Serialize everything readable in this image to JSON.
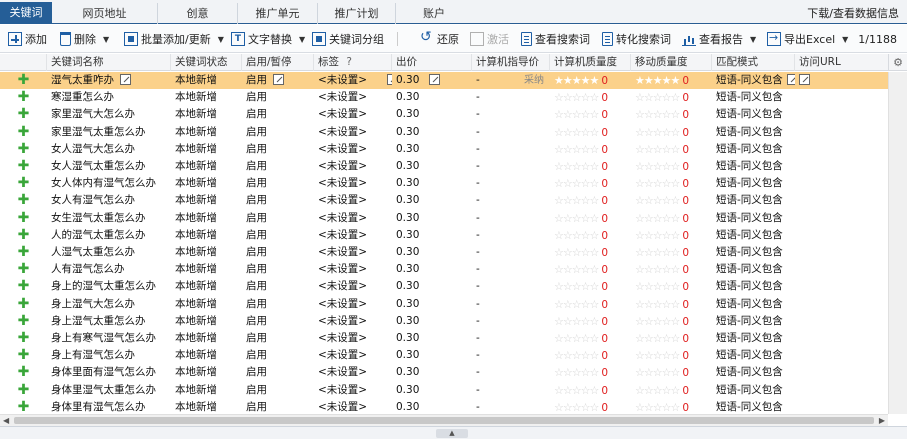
{
  "tabs": [
    {
      "label": "关键词",
      "active": true
    },
    {
      "label": "网页地址"
    },
    {
      "label": "创意"
    },
    {
      "label": "推广单元"
    },
    {
      "label": "推广计划"
    },
    {
      "label": "账户"
    }
  ],
  "tab_right": "下载/查看数据信息",
  "toolbar": {
    "add": "添加",
    "delete": "删除",
    "batch": "批量添加/更新",
    "text_replace": "文字替换",
    "group": "关键词分组",
    "restore": "还原",
    "activate": "激活",
    "search_terms": "查看搜索词",
    "convert_terms": "转化搜索词",
    "report": "查看报告",
    "export": "导出Excel",
    "pager": "1/1188"
  },
  "columns": [
    "关键词名称",
    "关键词状态",
    "启用/暂停",
    "标签",
    "出价",
    "计算机指导价",
    "计算机质量度",
    "移动质量度",
    "匹配模式",
    "访问URL"
  ],
  "tag_help": "?",
  "caina": "采纳",
  "stars": "☆☆☆☆☆",
  "stars_filled": "★★★★★",
  "quality_value": "0",
  "add_icon": "✚",
  "gear_icon": "⚙",
  "rows": [
    {
      "keyword": "湿气太重咋办",
      "status": "本地新增",
      "enabled": "启用",
      "tag": "<未设置>",
      "bid": "0.30",
      "guide": "-",
      "match": "短语-同义包含",
      "selected": true
    },
    {
      "keyword": "寒湿重怎么办",
      "status": "本地新增",
      "enabled": "启用",
      "tag": "<未设置>",
      "bid": "0.30",
      "guide": "-",
      "match": "短语-同义包含"
    },
    {
      "keyword": "家里湿气大怎么办",
      "status": "本地新增",
      "enabled": "启用",
      "tag": "<未设置>",
      "bid": "0.30",
      "guide": "-",
      "match": "短语-同义包含"
    },
    {
      "keyword": "家里湿气太重怎么办",
      "status": "本地新增",
      "enabled": "启用",
      "tag": "<未设置>",
      "bid": "0.30",
      "guide": "-",
      "match": "短语-同义包含"
    },
    {
      "keyword": "女人湿气大怎么办",
      "status": "本地新增",
      "enabled": "启用",
      "tag": "<未设置>",
      "bid": "0.30",
      "guide": "-",
      "match": "短语-同义包含"
    },
    {
      "keyword": "女人湿气太重怎么办",
      "status": "本地新增",
      "enabled": "启用",
      "tag": "<未设置>",
      "bid": "0.30",
      "guide": "-",
      "match": "短语-同义包含"
    },
    {
      "keyword": "女人体内有湿气怎么办",
      "status": "本地新增",
      "enabled": "启用",
      "tag": "<未设置>",
      "bid": "0.30",
      "guide": "-",
      "match": "短语-同义包含"
    },
    {
      "keyword": "女人有湿气怎么办",
      "status": "本地新增",
      "enabled": "启用",
      "tag": "<未设置>",
      "bid": "0.30",
      "guide": "-",
      "match": "短语-同义包含"
    },
    {
      "keyword": "女生湿气太重怎么办",
      "status": "本地新增",
      "enabled": "启用",
      "tag": "<未设置>",
      "bid": "0.30",
      "guide": "-",
      "match": "短语-同义包含"
    },
    {
      "keyword": "人的湿气太重怎么办",
      "status": "本地新增",
      "enabled": "启用",
      "tag": "<未设置>",
      "bid": "0.30",
      "guide": "-",
      "match": "短语-同义包含"
    },
    {
      "keyword": "人湿气太重怎么办",
      "status": "本地新增",
      "enabled": "启用",
      "tag": "<未设置>",
      "bid": "0.30",
      "guide": "-",
      "match": "短语-同义包含"
    },
    {
      "keyword": "人有湿气怎么办",
      "status": "本地新增",
      "enabled": "启用",
      "tag": "<未设置>",
      "bid": "0.30",
      "guide": "-",
      "match": "短语-同义包含"
    },
    {
      "keyword": "身上的湿气太重怎么办",
      "status": "本地新增",
      "enabled": "启用",
      "tag": "<未设置>",
      "bid": "0.30",
      "guide": "-",
      "match": "短语-同义包含"
    },
    {
      "keyword": "身上湿气大怎么办",
      "status": "本地新增",
      "enabled": "启用",
      "tag": "<未设置>",
      "bid": "0.30",
      "guide": "-",
      "match": "短语-同义包含"
    },
    {
      "keyword": "身上湿气太重怎么办",
      "status": "本地新增",
      "enabled": "启用",
      "tag": "<未设置>",
      "bid": "0.30",
      "guide": "-",
      "match": "短语-同义包含"
    },
    {
      "keyword": "身上有寒气湿气怎么办",
      "status": "本地新增",
      "enabled": "启用",
      "tag": "<未设置>",
      "bid": "0.30",
      "guide": "-",
      "match": "短语-同义包含"
    },
    {
      "keyword": "身上有湿气怎么办",
      "status": "本地新增",
      "enabled": "启用",
      "tag": "<未设置>",
      "bid": "0.30",
      "guide": "-",
      "match": "短语-同义包含"
    },
    {
      "keyword": "身体里面有湿气怎么办",
      "status": "本地新增",
      "enabled": "启用",
      "tag": "<未设置>",
      "bid": "0.30",
      "guide": "-",
      "match": "短语-同义包含"
    },
    {
      "keyword": "身体里湿气太重怎么办",
      "status": "本地新增",
      "enabled": "启用",
      "tag": "<未设置>",
      "bid": "0.30",
      "guide": "-",
      "match": "短语-同义包含"
    },
    {
      "keyword": "身体里有湿气怎么办",
      "status": "本地新增",
      "enabled": "启用",
      "tag": "<未设置>",
      "bid": "0.30",
      "guide": "-",
      "match": "短语-同义包含"
    }
  ]
}
